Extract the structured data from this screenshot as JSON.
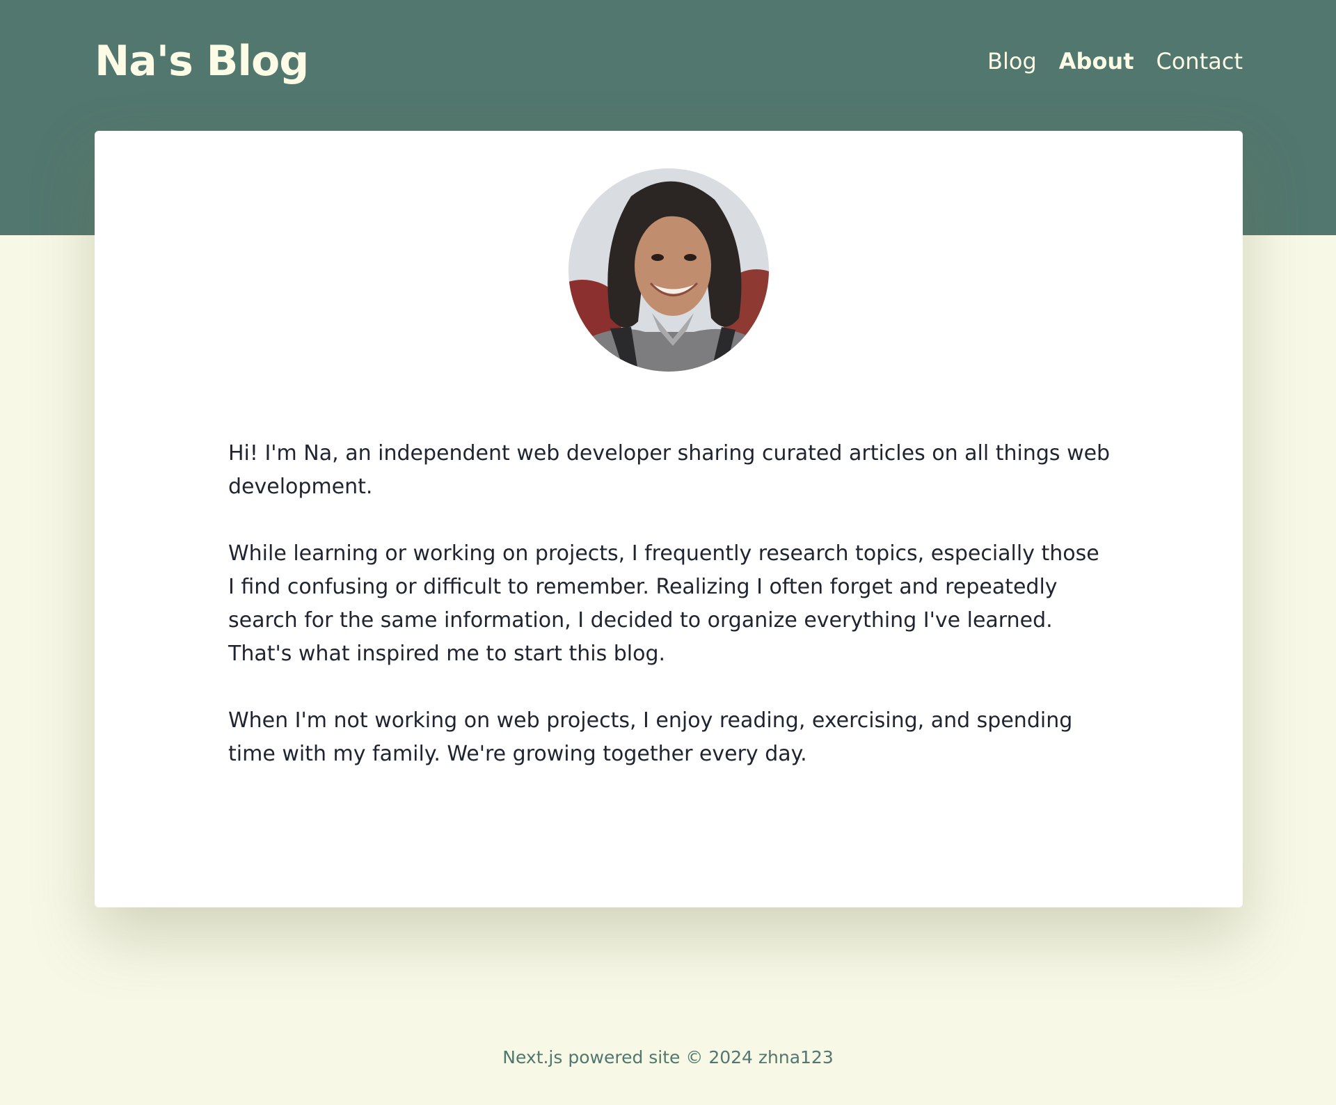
{
  "header": {
    "site_title": "Na's Blog",
    "nav": [
      {
        "label": "Blog",
        "active": false
      },
      {
        "label": "About",
        "active": true
      },
      {
        "label": "Contact",
        "active": false
      }
    ]
  },
  "about": {
    "avatar_alt": "avatar",
    "paragraphs": [
      "Hi! I'm Na, an independent web developer sharing curated articles on all things web development.",
      "While learning or working on projects, I frequently research topics, especially those I find confusing or difficult to remember. Realizing I often forget and repeatedly search for the same information, I decided to organize everything I've learned. That's what inspired me to start this blog.",
      "When I'm not working on web projects, I enjoy reading, exercising, and spending time with my family. We're growing together every day."
    ]
  },
  "footer": {
    "text": "Next.js powered site © 2024 zhna123"
  },
  "colors": {
    "header_bg": "#52776e",
    "page_bg": "#f7f8e6",
    "header_text": "#fbfbe6",
    "body_text": "#1f2430",
    "footer_text": "#52776e"
  }
}
